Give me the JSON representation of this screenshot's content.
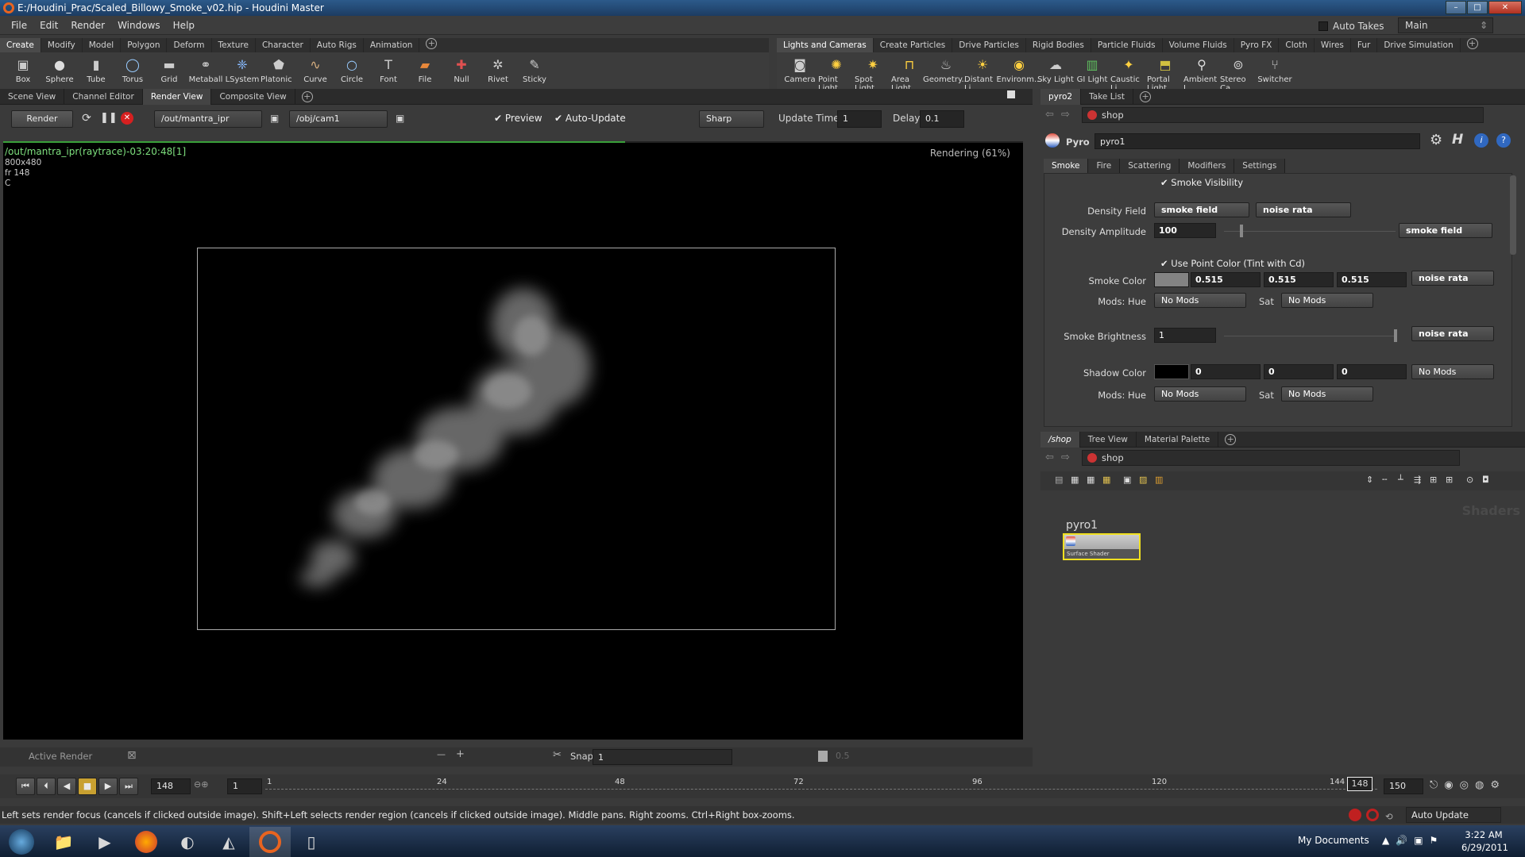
{
  "window": {
    "title": "E:/Houdini_Prac/Scaled_Billowy_Smoke_v02.hip - Houdini Master"
  },
  "menu": [
    "File",
    "Edit",
    "Render",
    "Windows",
    "Help"
  ],
  "auto_takes": "Auto Takes",
  "desktop": "Main",
  "shelf_left": {
    "tabs": [
      "Create",
      "Modify",
      "Model",
      "Polygon",
      "Deform",
      "Texture",
      "Character",
      "Auto Rigs",
      "Animation"
    ],
    "tools": [
      {
        "label": "Box",
        "icon": "box-icon"
      },
      {
        "label": "Sphere",
        "icon": "sphere-icon"
      },
      {
        "label": "Tube",
        "icon": "tube-icon"
      },
      {
        "label": "Torus",
        "icon": "torus-icon"
      },
      {
        "label": "Grid",
        "icon": "grid-icon"
      },
      {
        "label": "Metaball",
        "icon": "metaball-icon"
      },
      {
        "label": "LSystem",
        "icon": "lsystem-icon"
      },
      {
        "label": "Platonic ...",
        "icon": "platonic-icon"
      },
      {
        "label": "Curve",
        "icon": "curve-icon"
      },
      {
        "label": "Circle",
        "icon": "circle-icon"
      },
      {
        "label": "Font",
        "icon": "font-icon"
      },
      {
        "label": "File",
        "icon": "file-icon"
      },
      {
        "label": "Null",
        "icon": "null-icon"
      },
      {
        "label": "Rivet",
        "icon": "rivet-icon"
      },
      {
        "label": "Sticky",
        "icon": "sticky-icon"
      }
    ]
  },
  "shelf_right": {
    "tabs": [
      "Lights and Cameras",
      "Create Particles",
      "Drive Particles",
      "Rigid Bodies",
      "Particle Fluids",
      "Volume Fluids",
      "Pyro FX",
      "Cloth",
      "Wires",
      "Fur",
      "Drive Simulation"
    ],
    "tools": [
      {
        "label": "Camera",
        "icon": "camera-icon"
      },
      {
        "label": "Point Light",
        "icon": "point-light-icon"
      },
      {
        "label": "Spot Light",
        "icon": "spot-light-icon"
      },
      {
        "label": "Area Light",
        "icon": "area-light-icon"
      },
      {
        "label": "Geometry...",
        "icon": "geometry-light-icon"
      },
      {
        "label": "Distant Li...",
        "icon": "distant-light-icon"
      },
      {
        "label": "Environm...",
        "icon": "environment-light-icon"
      },
      {
        "label": "Sky Light",
        "icon": "sky-light-icon"
      },
      {
        "label": "GI Light",
        "icon": "gi-light-icon"
      },
      {
        "label": "Caustic Li...",
        "icon": "caustic-light-icon"
      },
      {
        "label": "Portal Light",
        "icon": "portal-light-icon"
      },
      {
        "label": "Ambient L...",
        "icon": "ambient-light-icon"
      },
      {
        "label": "Stereo Ca...",
        "icon": "stereo-camera-icon"
      },
      {
        "label": "Switcher",
        "icon": "switcher-icon"
      }
    ]
  },
  "left_pane": {
    "tabs": [
      "Scene View",
      "Channel Editor",
      "Render View",
      "Composite View"
    ],
    "active_tab": "Render View",
    "render_button": "Render",
    "output_driver": "/out/mantra_ipr",
    "camera": "/obj/cam1",
    "preview": "Preview",
    "auto_update": "Auto-Update",
    "filter": "Sharp",
    "update_time_label": "Update Time",
    "update_time": "1",
    "delay_label": "Delay",
    "delay": "0.1",
    "render_progress": 0.61,
    "overlay_title": "/out/mantra_ipr(raytrace)-03:20:48[1]",
    "overlay_res": "800x480",
    "overlay_frame": "fr 148",
    "overlay_c": "C",
    "rendering_status": "Rendering (61%)",
    "active_render": "Active Render",
    "snap_label": "Snap",
    "snap_value": "1",
    "zoom_value": "0.5"
  },
  "param_pane": {
    "tabs": [
      "pyro2",
      "Take List"
    ],
    "path": "shop",
    "node_type": "Pyro",
    "node_name": "pyro1",
    "subtabs": [
      "Smoke",
      "Fire",
      "Scattering",
      "Modifiers",
      "Settings"
    ],
    "smoke_visibility": "Smoke Visibility",
    "density_field_label": "Density Field",
    "density_field": "smoke field",
    "density_field_mod": "noise rata",
    "density_amplitude_label": "Density Amplitude",
    "density_amplitude": "100",
    "density_amplitude_mod": "smoke field",
    "use_point_color": "Use Point Color (Tint with Cd)",
    "smoke_color_label": "Smoke Color",
    "smoke_color_r": "0.515",
    "smoke_color_g": "0.515",
    "smoke_color_b": "0.515",
    "smoke_color_mod": "noise rata",
    "mods_hue_label": "Mods: Hue",
    "no_mods": "No Mods",
    "sat_label": "Sat",
    "smoke_brightness_label": "Smoke Brightness",
    "smoke_brightness": "1",
    "smoke_brightness_mod": "noise rata",
    "shadow_color_label": "Shadow Color",
    "shadow_r": "0",
    "shadow_g": "0",
    "shadow_b": "0",
    "shadow_mod": "No Mods"
  },
  "network_pane": {
    "tabs": [
      "/shop",
      "Tree View",
      "Material Palette"
    ],
    "path": "shop",
    "context_label": "Shaders",
    "node_name": "pyro1",
    "node_type": "Surface Shader"
  },
  "timeline": {
    "current_frame": "148",
    "step": "1",
    "start": "1",
    "end": "150",
    "ticks": [
      "1",
      "24",
      "48",
      "72",
      "96",
      "120",
      "144"
    ],
    "end_marker": "148",
    "auto_update": "Auto Update"
  },
  "status_text": "Left sets render focus (cancels if clicked outside image). Shift+Left selects render region (cancels if clicked outside image). Middle pans. Right zooms. Ctrl+Right box-zooms.",
  "taskbar": {
    "apps": [
      "start-orb-icon",
      "explorer-icon",
      "media-player-icon",
      "firefox-icon",
      "app-icon",
      "photoshop-icon",
      "houdini-icon",
      "notepad-icon"
    ],
    "my_documents": "My Documents",
    "time": "3:22 AM",
    "date": "6/29/2011"
  }
}
